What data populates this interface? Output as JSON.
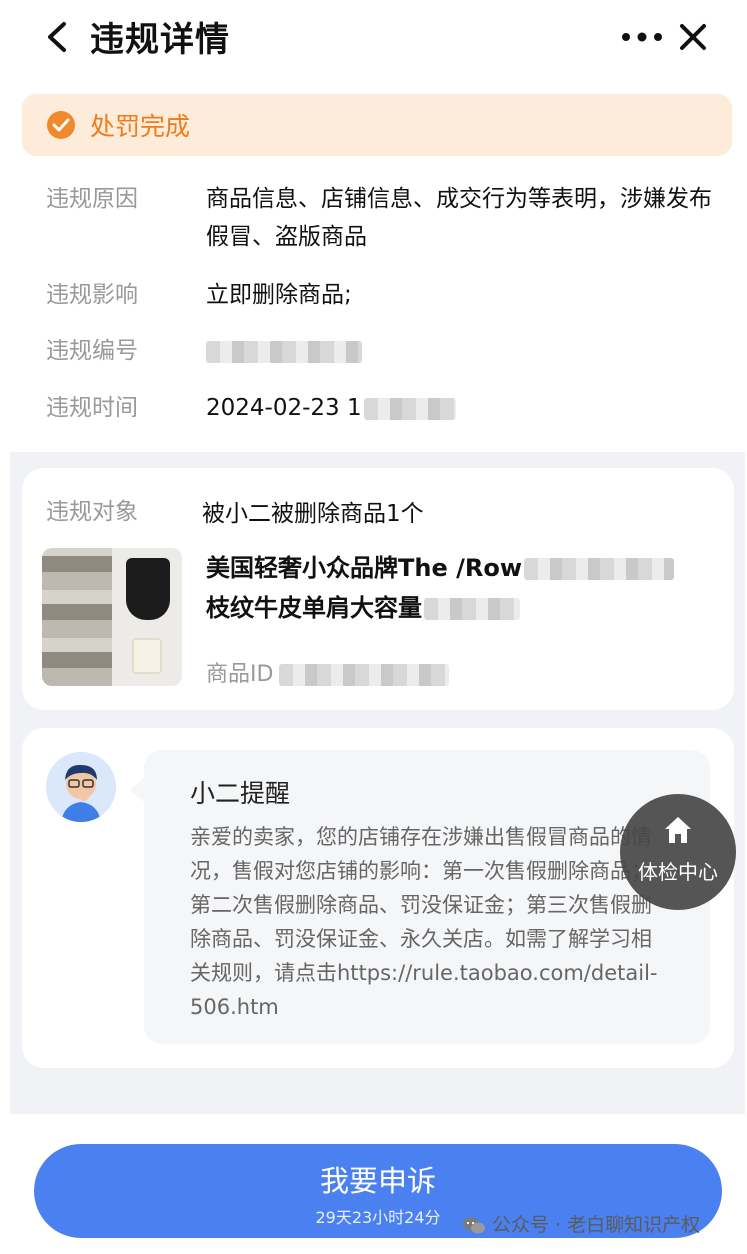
{
  "nav": {
    "title": "违规详情"
  },
  "status": {
    "text": "处罚完成",
    "color": "#f07a1c"
  },
  "info": [
    {
      "label": "违规原因",
      "value": "商品信息、店铺信息、成交行为等表明，涉嫌发布假冒、盗版商品"
    },
    {
      "label": "违规影响",
      "value": "立即删除商品;"
    },
    {
      "label": "违规编号",
      "value": ""
    },
    {
      "label": "违规时间",
      "value": "2024-02-23 1"
    }
  ],
  "target": {
    "label": "违规对象",
    "count": "被小二被删除商品1个",
    "product_name_line1": "美国轻奢小众品牌The /Row",
    "product_name_line2": "枝纹牛皮单肩大容量",
    "product_id_label": "商品ID"
  },
  "reminder": {
    "title": "小二提醒",
    "message": "亲爱的卖家，您的店铺存在涉嫌出售假冒商品的情况，售假对您店铺的影响：第一次售假删除商品；第二次售假删除商品、罚没保证金；第三次售假删除商品、罚没保证金、永久关店。如需了解学习相关规则，请点击https://rule.taobao.com/detail-506.htm"
  },
  "float_button": {
    "label": "体检中心",
    "icon": "home-icon"
  },
  "appeal": {
    "label": "我要申诉",
    "countdown": "29天23小时24分",
    "color": "#4a80f0"
  },
  "watermark": "公众号 · 老白聊知识产权"
}
